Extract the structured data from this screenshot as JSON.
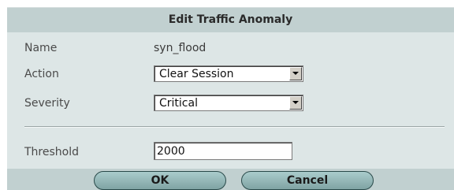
{
  "dialog": {
    "title": "Edit Traffic Anomaly"
  },
  "fields": {
    "name": {
      "label": "Name",
      "value": "syn_flood"
    },
    "action": {
      "label": "Action",
      "value": "Clear Session"
    },
    "severity": {
      "label": "Severity",
      "value": "Critical"
    },
    "threshold": {
      "label": "Threshold",
      "value": "2000"
    }
  },
  "buttons": {
    "ok_label": "OK",
    "cancel_label": "Cancel"
  }
}
